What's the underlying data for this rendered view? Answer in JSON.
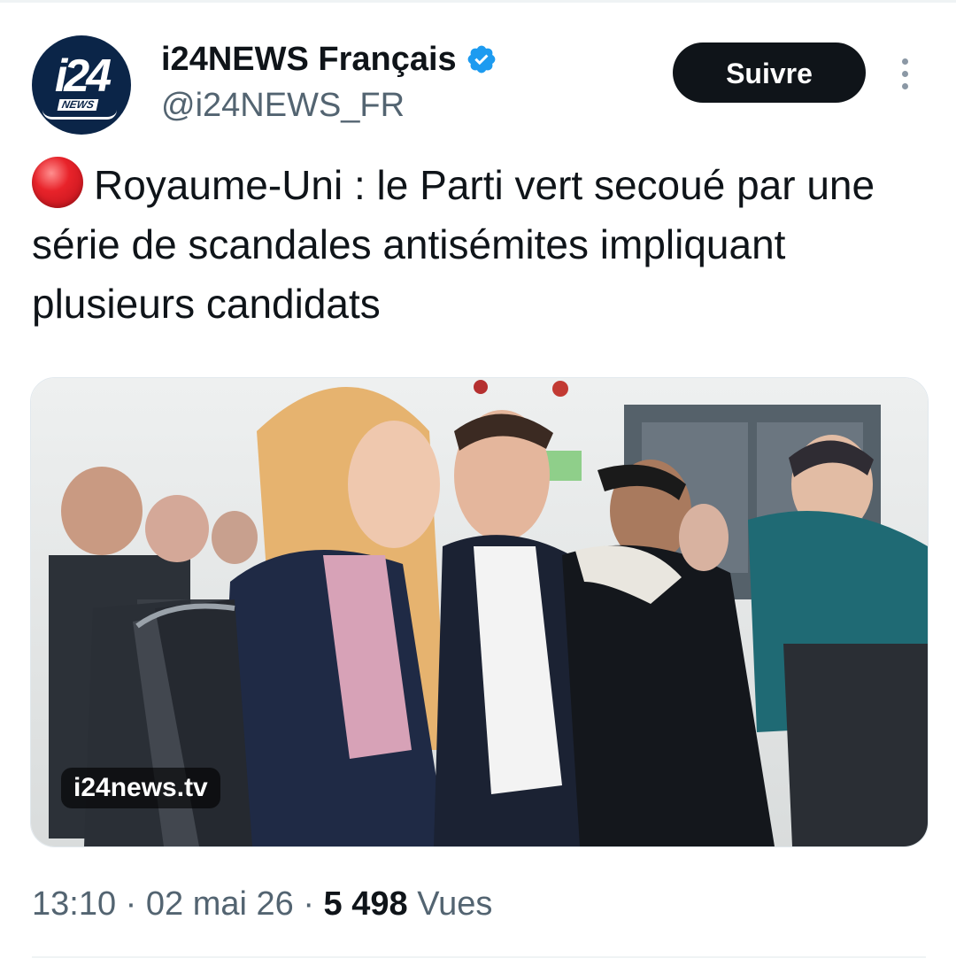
{
  "account": {
    "avatar_logo": "i24",
    "avatar_sub": "NEWS",
    "display_name": "i24NEWS Français",
    "handle": "@i24NEWS_FR",
    "verified": true,
    "verified_icon": "verified-badge-icon"
  },
  "actions": {
    "follow_label": "Suivre",
    "more_icon": "more-options-icon"
  },
  "tweet": {
    "emoji": "red-circle",
    "text": "Royaume-Uni : le Parti vert secoué par une série de scandales antisémites impliquant plusieurs candidats"
  },
  "media": {
    "watermark": "i24news.tv"
  },
  "meta": {
    "time": "13:10",
    "separator": "·",
    "date": "02 mai 26",
    "views_count": "5 498",
    "views_label": "Vues"
  },
  "colors": {
    "text": "#0f1419",
    "secondary": "#536471",
    "verified": "#1d9bf0",
    "button_bg": "#0f1419"
  }
}
